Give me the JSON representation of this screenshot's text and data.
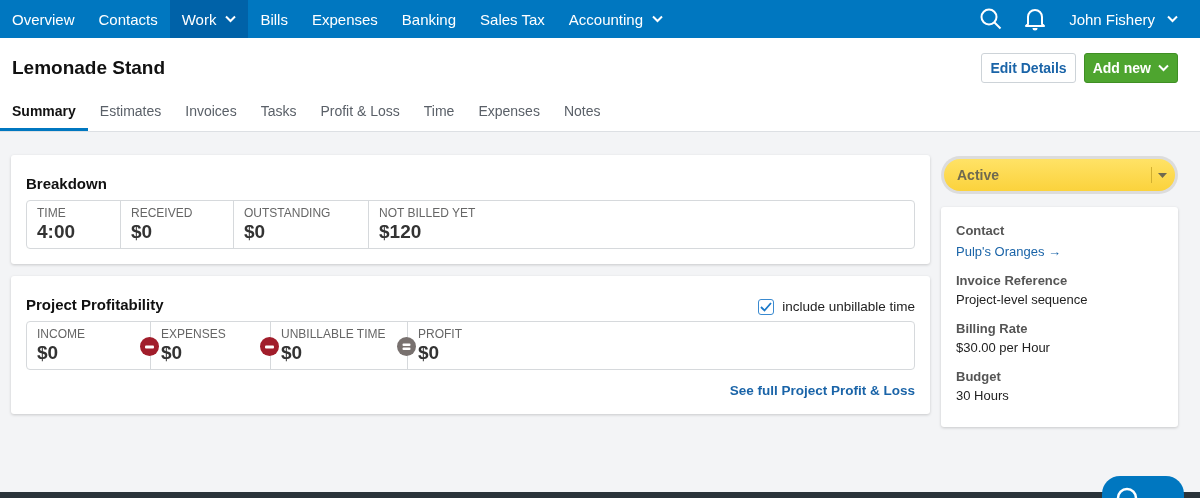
{
  "nav": {
    "items": [
      {
        "label": "Overview",
        "selected": false,
        "dropdown": false
      },
      {
        "label": "Contacts",
        "selected": false,
        "dropdown": false
      },
      {
        "label": "Work",
        "selected": true,
        "dropdown": true
      },
      {
        "label": "Bills",
        "selected": false,
        "dropdown": false
      },
      {
        "label": "Expenses",
        "selected": false,
        "dropdown": false
      },
      {
        "label": "Banking",
        "selected": false,
        "dropdown": false
      },
      {
        "label": "Sales Tax",
        "selected": false,
        "dropdown": false
      },
      {
        "label": "Accounting",
        "selected": false,
        "dropdown": true
      }
    ],
    "user": "John Fishery"
  },
  "page": {
    "title": "Lemonade Stand",
    "buttons": [
      {
        "label": "Edit Details",
        "kind": "secondary"
      },
      {
        "label": "Add new",
        "kind": "primary"
      }
    ],
    "tabs": [
      {
        "label": "Summary",
        "selected": true
      },
      {
        "label": "Estimates",
        "selected": false
      },
      {
        "label": "Invoices",
        "selected": false
      },
      {
        "label": "Tasks",
        "selected": false
      },
      {
        "label": "Profit & Loss",
        "selected": false
      },
      {
        "label": "Time",
        "selected": false
      },
      {
        "label": "Expenses",
        "selected": false
      },
      {
        "label": "Notes",
        "selected": false
      }
    ]
  },
  "breakdown": {
    "title": "Breakdown",
    "stats": [
      {
        "label": "TIME",
        "value": "4:00"
      },
      {
        "label": "RECEIVED",
        "value": "$0"
      },
      {
        "label": "OUTSTANDING",
        "value": "$0"
      },
      {
        "label": "NOT BILLED YET",
        "value": "$120"
      }
    ]
  },
  "profitability": {
    "title": "Project Profitability",
    "checkbox": {
      "label": "include unbillable time",
      "checked": true
    },
    "stats": [
      {
        "label": "INCOME",
        "value": "$0"
      },
      {
        "label": "EXPENSES",
        "value": "$0",
        "kind": "minus"
      },
      {
        "label": "UNBILLABLE TIME",
        "value": "$0",
        "kind": "minus"
      },
      {
        "label": "PROFIT",
        "value": "$0",
        "kind": "equals"
      }
    ],
    "link": "See full Project Profit & Loss"
  },
  "status": {
    "label": "Active"
  },
  "details": [
    {
      "label": "Contact",
      "value": "Pulp's Oranges →",
      "kind": "link"
    },
    {
      "label": "Invoice Reference",
      "value": "Project-level sequence",
      "kind": "text"
    },
    {
      "label": "Billing Rate",
      "value": "$30.00 per Hour",
      "kind": "text"
    },
    {
      "label": "Budget",
      "value": "30 Hours",
      "kind": "text"
    }
  ]
}
